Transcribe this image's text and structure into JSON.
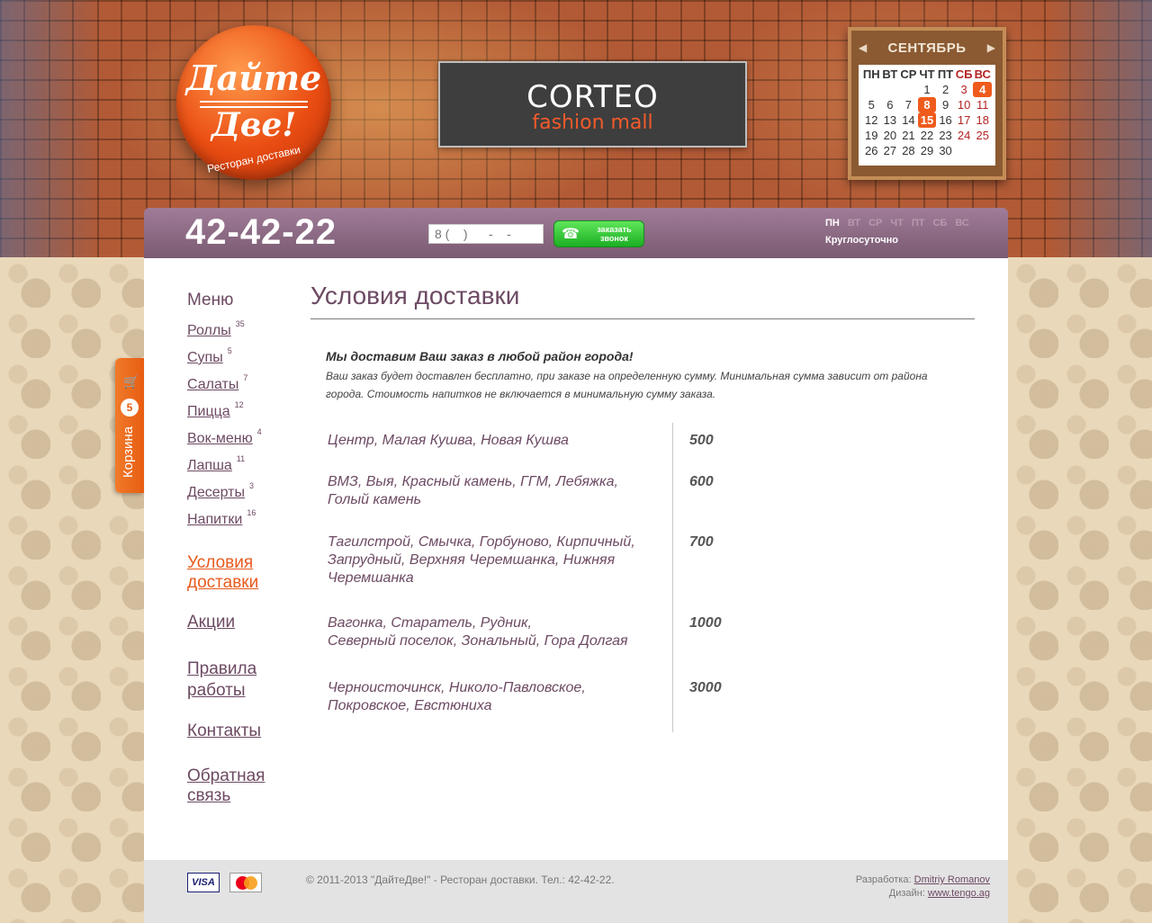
{
  "header": {
    "logo": {
      "line1": "Дайте",
      "line2": "Две!",
      "subtitle": "Ресторан доставки"
    },
    "banner": {
      "brand": "CORTEO",
      "tagline": "fashion mall"
    },
    "calendar": {
      "month": "СЕНТЯБРЬ",
      "weekdays": [
        "ПН",
        "ВТ",
        "СР",
        "ЧТ",
        "ПТ",
        "СБ",
        "ВС"
      ],
      "weeks": [
        [
          "",
          "",
          "",
          "1",
          "2",
          "3",
          "4"
        ],
        [
          "5",
          "6",
          "7",
          "8",
          "9",
          "10",
          "11"
        ],
        [
          "12",
          "13",
          "14",
          "15",
          "16",
          "17",
          "18"
        ],
        [
          "19",
          "20",
          "21",
          "22",
          "23",
          "24",
          "25"
        ],
        [
          "26",
          "27",
          "28",
          "29",
          "30",
          "",
          ""
        ]
      ],
      "highlighted": [
        "4",
        "8",
        "15"
      ]
    }
  },
  "phone_bar": {
    "phone": "42-42-22",
    "callback_placeholder": "8 (    )      -    -",
    "callback_button": "заказать звонок",
    "days": [
      "ПН",
      "ВТ",
      "СР",
      "ЧТ",
      "ПТ",
      "СБ",
      "ВС"
    ],
    "hours": "Круглосуточно"
  },
  "cart": {
    "count": "5",
    "label": "Корзина"
  },
  "sidebar": {
    "title": "Меню",
    "items": [
      {
        "label": "Роллы",
        "count": "35"
      },
      {
        "label": "Супы",
        "count": "5"
      },
      {
        "label": "Салаты",
        "count": "7"
      },
      {
        "label": "Пицца",
        "count": "12"
      },
      {
        "label": "Вок-меню",
        "count": "4"
      },
      {
        "label": "Лапша",
        "count": "11"
      },
      {
        "label": "Десерты",
        "count": "3"
      },
      {
        "label": "Напитки",
        "count": "16"
      }
    ],
    "links": [
      {
        "line1": "Условия",
        "line2": "доставки"
      },
      {
        "line1": "Акции",
        "line2": ""
      },
      {
        "line1": "Правила",
        "line2": "работы"
      },
      {
        "line1": "Контакты",
        "line2": ""
      },
      {
        "line1": "Обратная",
        "line2": "связь"
      }
    ]
  },
  "main": {
    "title": "Условия доставки",
    "intro_bold": "Мы доставим Ваш заказ в любой район города!",
    "intro_text": "Ваш заказ будет доставлен бесплатно, при заказе на определенную сумму. Минимальная сумма зависит от района города. Стоимость напитков не включается в минимальную сумму заказа.",
    "zones": [
      {
        "lines": [
          "Центр, Малая Кушва, Новая Кушва"
        ],
        "min": "500"
      },
      {
        "lines": [
          "ВМЗ, Выя, Красный камень, ГГМ, Лебяжка,",
          "Голый камень"
        ],
        "min": "600"
      },
      {
        "lines": [
          "Тагилстрой, Смычка, Горбуново, Кирпичный,",
          "Запрудный, Верхняя Черемшанка, Нижняя",
          "Черемшанка"
        ],
        "min": "700"
      },
      {
        "lines": [
          "Вагонка, Старатель, Рудник,",
          "Северный поселок, Зональный, Гора Долгая"
        ],
        "min": "1000"
      },
      {
        "lines": [
          "Черноисточинск, Николо-Павловское,",
          "Покровское, Евстюниха"
        ],
        "min": "3000"
      }
    ]
  },
  "footer": {
    "visa": "VISA",
    "mastercard": "MasterCard",
    "copyright": "© 2011-2013 \"ДайтеДве!\" - Ресторан доставки.  Тел.: 42-42-22.",
    "dev_label": "Разработка:",
    "dev_name": "Dmitriy Romanov",
    "design_label": "Дизайн:",
    "design_link": "www.tengo.ag"
  },
  "colors": {
    "accent": "#e85a1c",
    "purple": "#6d4a63",
    "bar": "#8a6a84",
    "green": "#2dbe33"
  }
}
